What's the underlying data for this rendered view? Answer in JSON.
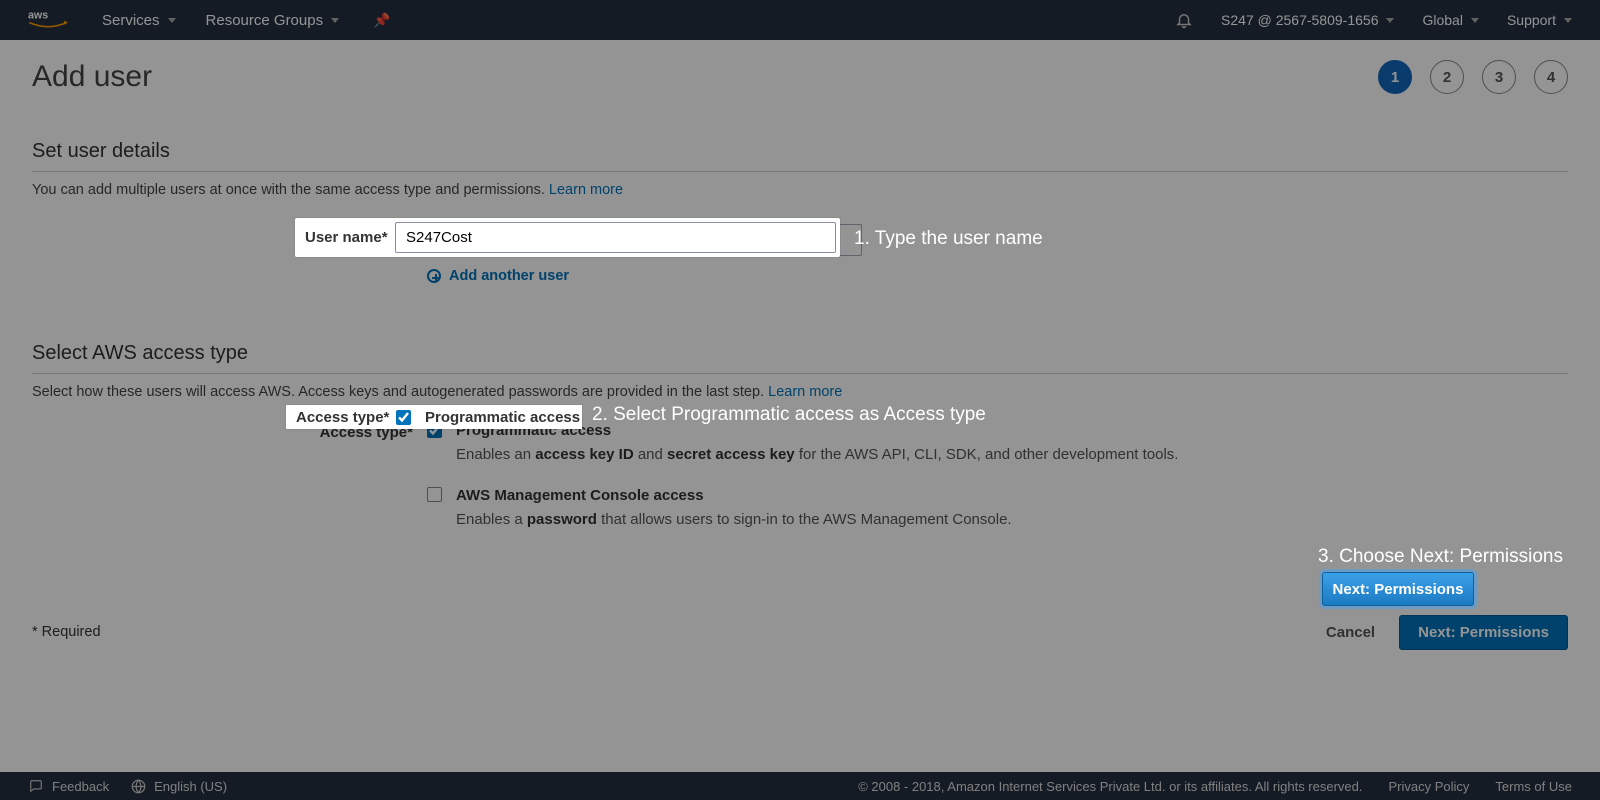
{
  "header": {
    "services": "Services",
    "resource_groups": "Resource Groups",
    "account": "S247 @ 2567-5809-1656",
    "region": "Global",
    "support": "Support"
  },
  "page": {
    "title": "Add user",
    "steps": [
      "1",
      "2",
      "3",
      "4"
    ],
    "active_step_index": 0
  },
  "section_details": {
    "heading": "Set user details",
    "subtext": "You can add multiple users at once with the same access type and permissions.",
    "learn_more": "Learn more",
    "username_label": "User name*",
    "username_value": "S247Cost",
    "add_another": "Add another user"
  },
  "section_accesstype": {
    "heading": "Select AWS access type",
    "subtext": "Select how these users will access AWS. Access keys and autogenerated passwords are provided in the last step.",
    "learn_more": "Learn more",
    "label": "Access type*",
    "opt1_title": "Programmatic access",
    "opt1_desc_a": "Enables an ",
    "opt1_desc_b": "access key ID",
    "opt1_desc_c": " and ",
    "opt1_desc_d": "secret access key",
    "opt1_desc_e": " for the AWS API, CLI, SDK, and other development tools.",
    "opt2_title": "AWS Management Console access",
    "opt2_desc_a": "Enables a ",
    "opt2_desc_b": "password",
    "opt2_desc_c": " that allows users to sign-in to the AWS Management Console."
  },
  "footer_actions": {
    "required": "* Required",
    "cancel": "Cancel",
    "next": "Next: Permissions"
  },
  "callouts": {
    "c1": "1. Type the user name",
    "c2": "2. Select Programmatic access as Access type",
    "c3": "3. Choose Next: Permissions"
  },
  "footer": {
    "feedback": "Feedback",
    "language": "English (US)",
    "copyright": "© 2008 - 2018, Amazon Internet Services Private Ltd. or its affiliates. All rights reserved.",
    "privacy": "Privacy Policy",
    "terms": "Terms of Use"
  }
}
